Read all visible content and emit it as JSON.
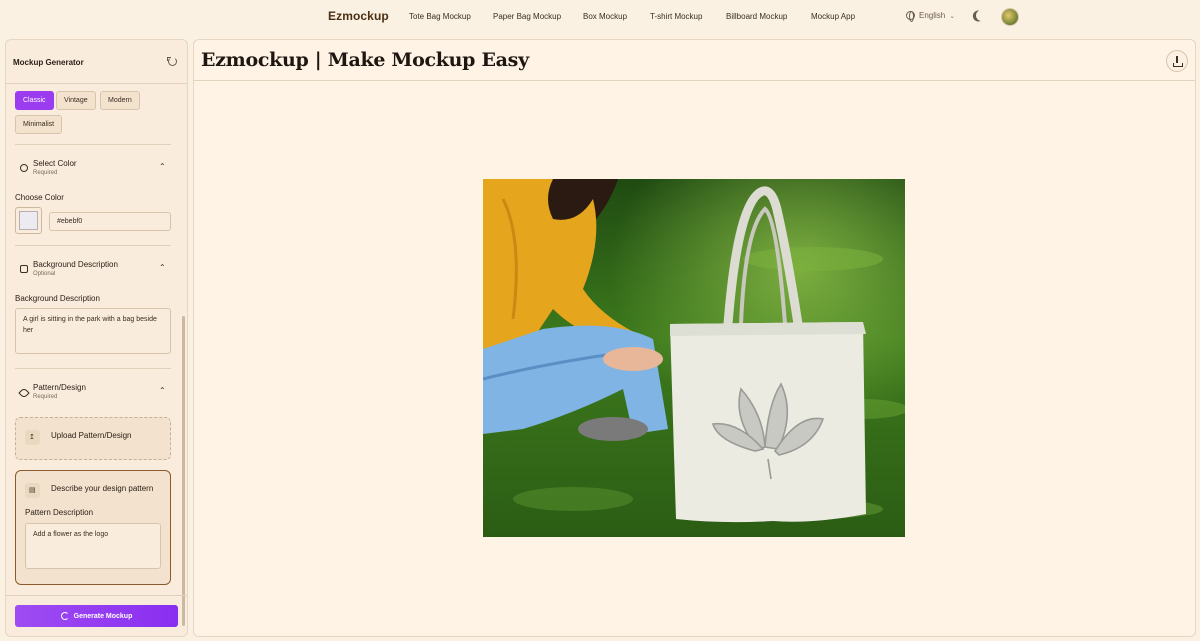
{
  "nav": {
    "brand": "Ezmockup",
    "links": [
      "Tote Bag Mockup",
      "Paper Bag Mockup",
      "Box Mockup",
      "T-shirt Mockup",
      "Billboard Mockup",
      "Mockup App"
    ],
    "language": "English"
  },
  "sidebar": {
    "title": "Mockup Generator",
    "styles": [
      "Classic",
      "Vintage",
      "Modern",
      "Minimalist"
    ],
    "active_style": "Classic",
    "color_section": {
      "title": "Select Color",
      "subtitle": "Required",
      "choose_label": "Choose Color",
      "value": "#ebebf0"
    },
    "background_section": {
      "title": "Background Description",
      "subtitle": "Optional",
      "field_label": "Background Description",
      "value": "A girl is sitting in the park with a bag beside her"
    },
    "pattern_section": {
      "title": "Pattern/Design",
      "subtitle": "Required",
      "upload_label": "Upload Pattern/Design",
      "describe_label": "Describe your design pattern",
      "field_label": "Pattern Description",
      "value": "Add a flower as the logo"
    },
    "generate_label": "Generate Mockup"
  },
  "main": {
    "title": "Ezmockup | Make Mockup Easy"
  },
  "colors": {
    "accent": "#9b3cf0",
    "background": "#fbf1e3",
    "panel": "#fff3e5",
    "tote": "#ebebf0"
  }
}
